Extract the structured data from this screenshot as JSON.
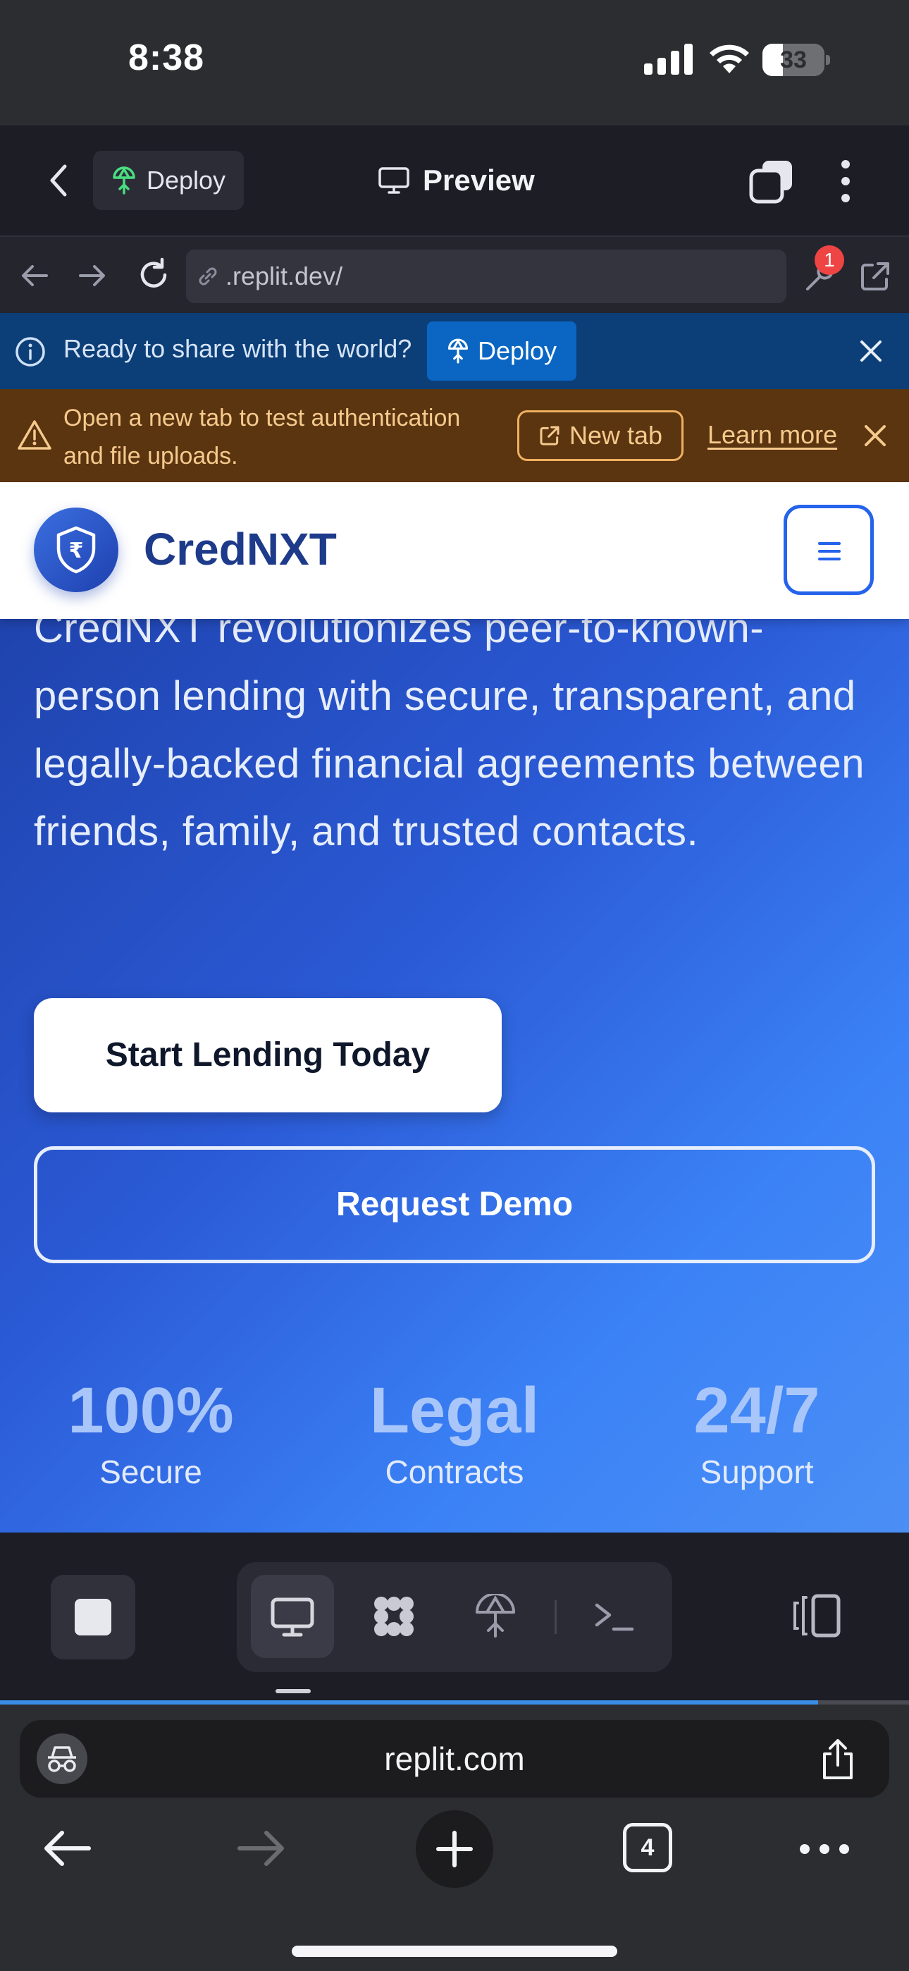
{
  "status_bar": {
    "time": "8:38",
    "battery_percent": 33,
    "battery_text": "33"
  },
  "replit_header": {
    "deploy_label": "Deploy",
    "preview_label": "Preview"
  },
  "url_bar": {
    "url": ".replit.dev/",
    "devtools_badge": "1"
  },
  "deploy_banner": {
    "text": "Ready to share with the world?",
    "button_label": "Deploy"
  },
  "auth_banner": {
    "line1": "Open a new tab to test authentication",
    "line2": "and file uploads.",
    "new_tab_label": "New tab",
    "learn_more_label": "Learn more"
  },
  "app": {
    "brand": "CredNXT",
    "hero_description": "CredNXT revolutionizes peer-to-known-person lending with secure, transparent, and legally-backed financial agreements between friends, family, and trusted contacts.",
    "primary_cta": "Start Lending Today",
    "secondary_cta": "Request Demo",
    "stats": [
      {
        "value": "100%",
        "label": "Secure"
      },
      {
        "value": "Legal",
        "label": "Contracts"
      },
      {
        "value": "24/7",
        "label": "Support"
      }
    ],
    "colors": {
      "brand_navy": "#1e3a8a",
      "accent_blue": "#2563eb",
      "hero_gradient_start": "#1d3fa6",
      "hero_gradient_end": "#4b8ff5"
    }
  },
  "tool_dock": {
    "icons": [
      "stop-icon",
      "monitor-icon",
      "apps-grid-icon",
      "deploy-icon",
      "terminal-icon",
      "layout-icon"
    ],
    "active": "monitor-icon"
  },
  "safari": {
    "address": "replit.com",
    "tab_count": "4",
    "load_progress_percent": 90
  }
}
